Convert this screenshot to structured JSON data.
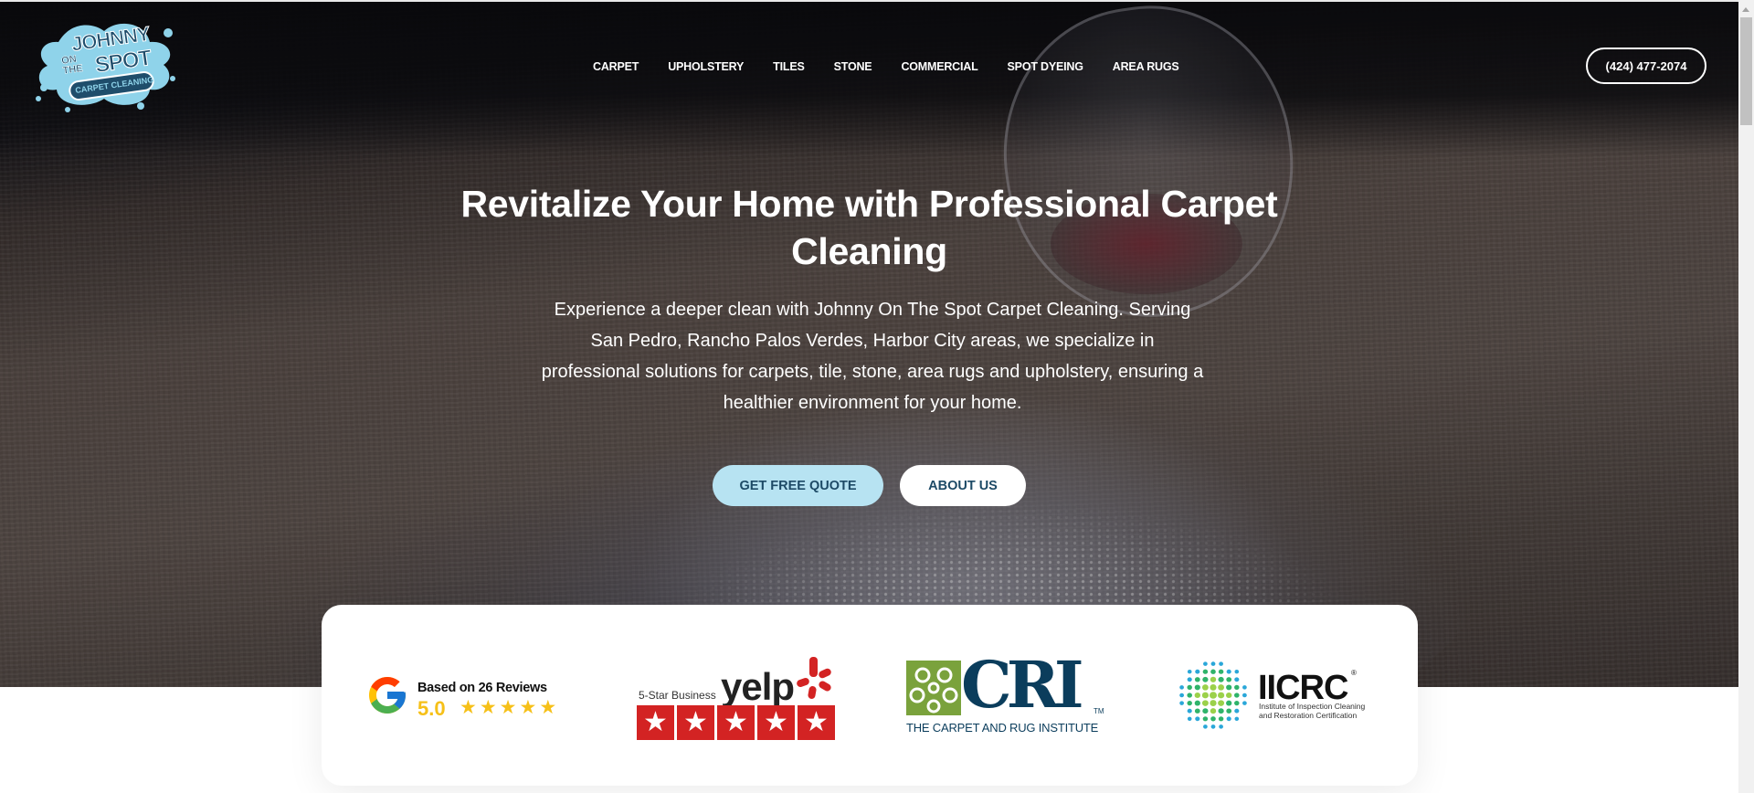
{
  "header": {
    "logo": {
      "line1": "JOHNNY",
      "line2": "ON THE",
      "line3": "SPOT",
      "tagline": "CARPET CLEANING"
    },
    "nav": [
      {
        "label": "CARPET"
      },
      {
        "label": "UPHOLSTERY"
      },
      {
        "label": "TILES"
      },
      {
        "label": "STONE"
      },
      {
        "label": "COMMERCIAL"
      },
      {
        "label": "SPOT DYEING"
      },
      {
        "label": "AREA RUGS"
      }
    ],
    "phone_label": "(424) 477-2074"
  },
  "hero": {
    "title": "Revitalize Your Home with Professional Carpet Cleaning",
    "subtitle": "Experience a deeper clean with Johnny On The Spot Carpet Cleaning. Serving San Pedro, Rancho Palos Verdes, Harbor City  areas, we specialize in professional solutions for carpets, tile, stone, area rugs and upholstery, ensuring a healthier environment for your home.",
    "buttons": {
      "quote": "GET FREE QUOTE",
      "about": "ABOUT US"
    }
  },
  "badges": {
    "google": {
      "text": "Based on 26 Reviews",
      "rating": "5.0",
      "stars": 5,
      "star_glyph": "★"
    },
    "yelp": {
      "label": "5-Star Business",
      "word": "yelp",
      "stars": 5,
      "star_glyph": "★"
    },
    "cri": {
      "word": "CRI",
      "tm": "TM",
      "name": "THE CARPET AND RUG INSTITUTE"
    },
    "iicrc": {
      "word": "IICRC",
      "reg": "®",
      "sub": "Institute of Inspection Cleaning and Restoration Certification"
    }
  },
  "colors": {
    "quote_button": "#b7e3f2",
    "button_text": "#1d4a66",
    "google_gold": "#f6c018",
    "yelp_red": "#d32323",
    "cri_green": "#7aa23c",
    "cri_navy": "#0b3d5c",
    "logo_blue": "#8fd3ea",
    "logo_navy": "#1f4d6b"
  }
}
